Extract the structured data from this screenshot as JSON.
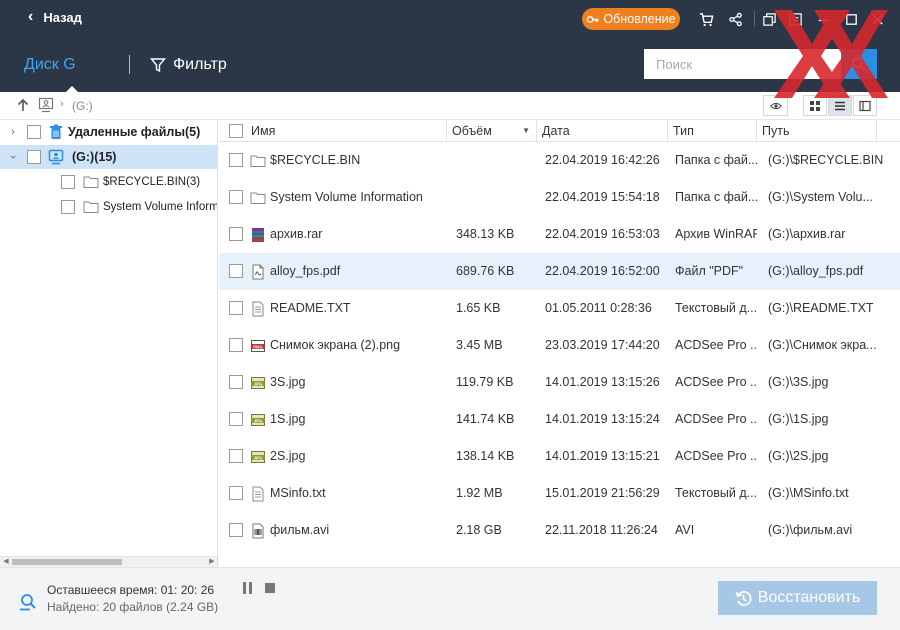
{
  "header": {
    "back_label": "Назад",
    "update_label": "Обновление",
    "icons": [
      "cart-icon",
      "share-icon",
      "restore-window-icon",
      "menu-icon",
      "minimize-icon",
      "maximize-icon",
      "close-icon"
    ]
  },
  "nav": {
    "disk_tab": "Диск G",
    "filter_label": "Фильтр",
    "search_placeholder": "Поиск"
  },
  "path": {
    "crumb": "(G:)"
  },
  "tree": {
    "items": [
      {
        "label": "Удаленные файлы(5)"
      },
      {
        "label": "(G:)(15)"
      },
      {
        "label": "$RECYCLE.BIN(3)"
      },
      {
        "label": "System Volume Informat"
      }
    ]
  },
  "table": {
    "columns": {
      "name": "Имя",
      "size": "Объём",
      "date": "Дата",
      "type": "Тип",
      "path": "Путь"
    },
    "rows": [
      {
        "name": "$RECYCLE.BIN",
        "size": "",
        "date": "22.04.2019 16:42:26",
        "type": "Папка с фай...",
        "path": "(G:)\\$RECYCLE.BIN",
        "icon": "folder-icon"
      },
      {
        "name": "System Volume Information",
        "size": "",
        "date": "22.04.2019 15:54:18",
        "type": "Папка с фай...",
        "path": "(G:)\\System Volu...",
        "icon": "folder-icon"
      },
      {
        "name": "архив.rar",
        "size": "348.13 KB",
        "date": "22.04.2019 16:53:03",
        "type": "Архив WinRAR",
        "path": "(G:)\\архив.rar",
        "icon": "rar-icon"
      },
      {
        "name": "alloy_fps.pdf",
        "size": "689.76 KB",
        "date": "22.04.2019 16:52:00",
        "type": "Файл \"PDF\"",
        "path": "(G:)\\alloy_fps.pdf",
        "icon": "pdf-icon"
      },
      {
        "name": "README.TXT",
        "size": "1.65 KB",
        "date": "01.05.2011 0:28:36",
        "type": "Текстовый д...",
        "path": "(G:)\\README.TXT",
        "icon": "text-file-icon"
      },
      {
        "name": "Снимок экрана (2).png",
        "size": "3.45 MB",
        "date": "23.03.2019 17:44:20",
        "type": "ACDSee Pro ...",
        "path": "(G:)\\Снимок экра...",
        "icon": "png-icon"
      },
      {
        "name": "3S.jpg",
        "size": "119.79 KB",
        "date": "14.01.2019 13:15:26",
        "type": "ACDSee Pro ...",
        "path": "(G:)\\3S.jpg",
        "icon": "jpg-icon"
      },
      {
        "name": "1S.jpg",
        "size": "141.74 KB",
        "date": "14.01.2019 13:15:24",
        "type": "ACDSee Pro ...",
        "path": "(G:)\\1S.jpg",
        "icon": "jpg-icon"
      },
      {
        "name": "2S.jpg",
        "size": "138.14 KB",
        "date": "14.01.2019 13:15:21",
        "type": "ACDSee Pro ...",
        "path": "(G:)\\2S.jpg",
        "icon": "jpg-icon"
      },
      {
        "name": "MSinfo.txt",
        "size": "1.92 MB",
        "date": "15.01.2019 21:56:29",
        "type": "Текстовый д...",
        "path": "(G:)\\MSinfo.txt",
        "icon": "text-file-icon"
      },
      {
        "name": "фильм.avi",
        "size": "2.18 GB",
        "date": "22.11.2018 11:26:24",
        "type": "AVI",
        "path": "(G:)\\фильм.avi",
        "icon": "video-file-icon"
      }
    ]
  },
  "status": {
    "remaining_time": "Оставшееся время: 01: 20: 26",
    "found": "Найдено: 20 файлов (2.24 GB)",
    "recover_label": "Восстановить"
  },
  "colors": {
    "header_bg": "#2b3647",
    "accent_orange": "#f0801e",
    "tab_blue": "#3ea6f2",
    "search_btn": "#2a8fe3",
    "selection": "#cfe3f6",
    "recover_btn": "#a6c8e6"
  }
}
